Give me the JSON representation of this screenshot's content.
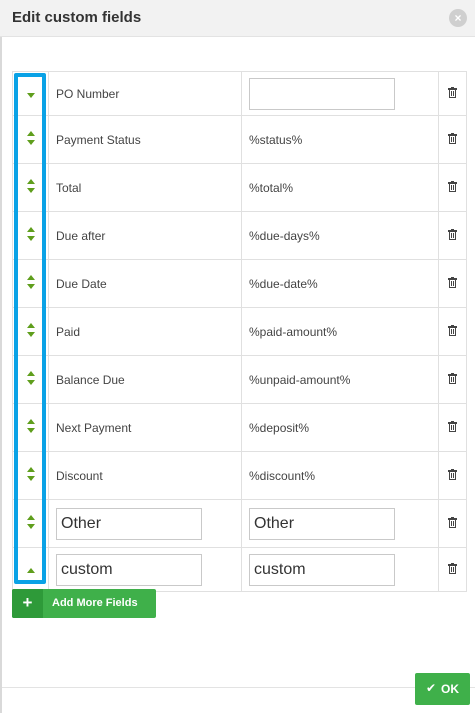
{
  "dialog": {
    "title": "Edit custom fields",
    "close_icon": "×",
    "accent_color": "#0aa2e6",
    "button_color": "#3fb04a"
  },
  "fields": [
    {
      "handle": "down",
      "name": "PO Number",
      "name_editable": false,
      "value": "",
      "value_editable": true
    },
    {
      "handle": "both",
      "name": "Payment Status",
      "name_editable": false,
      "value": "%status%",
      "value_editable": false
    },
    {
      "handle": "both",
      "name": "Total",
      "name_editable": false,
      "value": "%total%",
      "value_editable": false
    },
    {
      "handle": "both",
      "name": "Due after",
      "name_editable": false,
      "value": "%due-days%",
      "value_editable": false
    },
    {
      "handle": "both",
      "name": "Due Date",
      "name_editable": false,
      "value": "%due-date%",
      "value_editable": false
    },
    {
      "handle": "both",
      "name": "Paid",
      "name_editable": false,
      "value": "%paid-amount%",
      "value_editable": false
    },
    {
      "handle": "both",
      "name": "Balance Due",
      "name_editable": false,
      "value": "%unpaid-amount%",
      "value_editable": false
    },
    {
      "handle": "both",
      "name": "Next Payment",
      "name_editable": false,
      "value": "%deposit%",
      "value_editable": false
    },
    {
      "handle": "both",
      "name": "Discount",
      "name_editable": false,
      "value": "%discount%",
      "value_editable": false
    },
    {
      "handle": "both",
      "name": "Other",
      "name_editable": true,
      "value": "Other",
      "value_editable": true
    },
    {
      "handle": "up",
      "name": "custom",
      "name_editable": true,
      "value": "custom",
      "value_editable": true
    }
  ],
  "actions": {
    "add_icon": "+",
    "add_label": "Add More Fields",
    "ok_icon": "✔",
    "ok_label": "OK"
  }
}
